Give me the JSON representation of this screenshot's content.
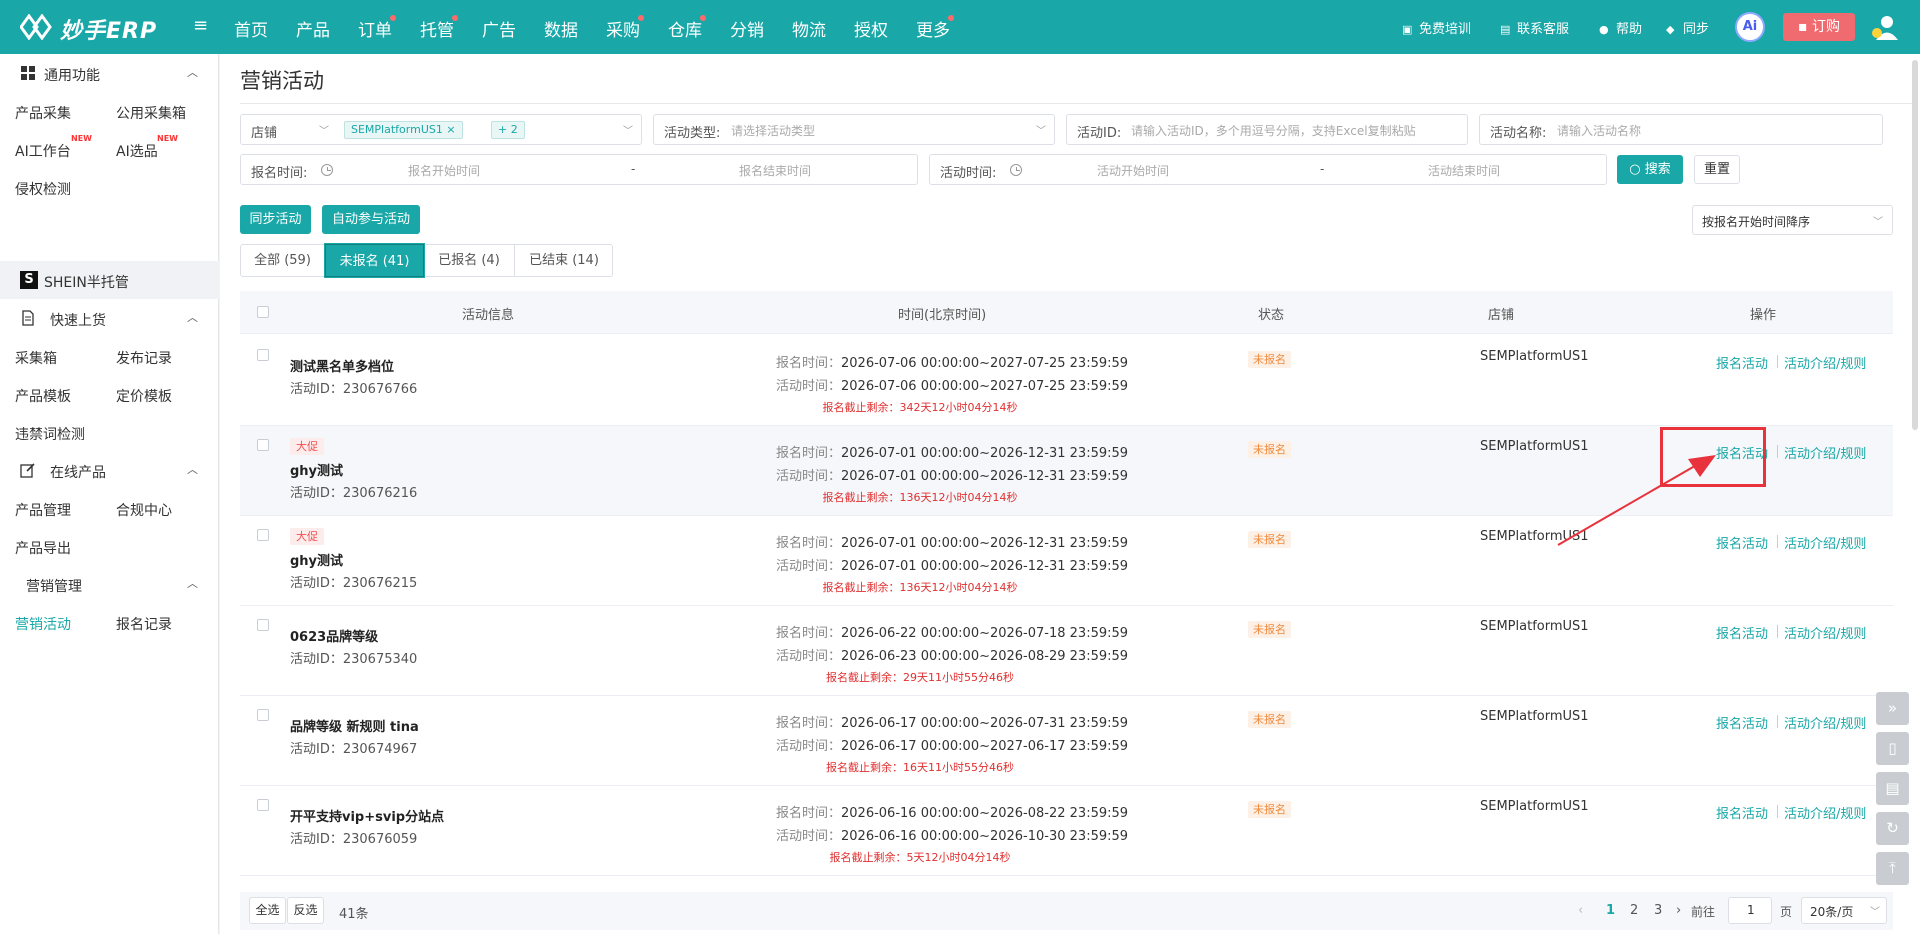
{
  "header": {
    "logo_text": "妙手ERP",
    "nav": [
      {
        "label": "首页",
        "dot": false
      },
      {
        "label": "产品",
        "dot": false
      },
      {
        "label": "订单",
        "dot": true
      },
      {
        "label": "托管",
        "dot": true
      },
      {
        "label": "广告",
        "dot": false
      },
      {
        "label": "数据",
        "dot": false
      },
      {
        "label": "采购",
        "dot": true
      },
      {
        "label": "仓库",
        "dot": true
      },
      {
        "label": "分销",
        "dot": false
      },
      {
        "label": "物流",
        "dot": false
      },
      {
        "label": "授权",
        "dot": false
      },
      {
        "label": "更多",
        "dot": true
      }
    ],
    "right": {
      "training": "免费培训",
      "service": "联系客服",
      "help": "帮助",
      "sync": "同步",
      "ai": "Ai",
      "order": "订购"
    }
  },
  "sidebar": {
    "general": "通用功能",
    "product_collect": "产品采集",
    "public_collect": "公用采集箱",
    "ai_workbench": "AI工作台",
    "ai_select": "AI选品",
    "new_badge": "NEW",
    "infringe": "侵权检测",
    "shein": "SHEIN半托管",
    "quick_upload": "快速上货",
    "collect_box": "采集箱",
    "publish_log": "发布记录",
    "product_template": "产品模板",
    "price_template": "定价模板",
    "banned_words": "违禁词检测",
    "online_products": "在线产品",
    "product_manage": "产品管理",
    "compliance": "合规中心",
    "product_export": "产品导出",
    "marketing": "营销管理",
    "campaigns": "营销活动",
    "signup_log": "报名记录"
  },
  "page": {
    "title": "营销活动",
    "filters": {
      "shop_label": "店铺",
      "shop_tag": "SEMPlatformUS1",
      "shop_more": "+ 2",
      "type_label": "活动类型:",
      "type_ph": "请选择活动类型",
      "id_label": "活动ID:",
      "id_ph": "请输入活动ID，多个用逗号分隔，支持Excel复制粘贴",
      "name_label": "活动名称:",
      "name_ph": "请输入活动名称",
      "signup_label": "报名时间:",
      "signup_start": "报名开始时间",
      "signup_end": "报名结束时间",
      "act_label": "活动时间:",
      "act_start": "活动开始时间",
      "act_end": "活动结束时间",
      "dash": "-",
      "search": "搜索",
      "reset": "重置"
    },
    "sync_btn": "同步活动",
    "auto_btn": "自动参与活动",
    "sort": "按报名开始时间降序",
    "tabs": [
      "全部 (59)",
      "未报名 (41)",
      "已报名 (4)",
      "已结束 (14)"
    ],
    "columns": {
      "info": "活动信息",
      "time": "时间(北京时间)",
      "status": "状态",
      "shop": "店铺",
      "ops": "操作"
    },
    "labels": {
      "signup_time": "报名时间：",
      "activity_time": "活动时间：",
      "remaining": "报名截止剩余：",
      "id_prefix": "活动ID：",
      "signup_op": "报名活动",
      "rules_op": "活动介绍/规则"
    },
    "rows": [
      {
        "promo": "",
        "name": "测试黑名单多档位",
        "id": "230676766",
        "signup": "2026-07-06 00:00:00~2027-07-25 23:59:59",
        "activity": "2026-07-06 00:00:00~2027-07-25 23:59:59",
        "remain": "342天12小时04分14秒",
        "status": "未报名",
        "shop": "SEMPlatformUS1"
      },
      {
        "promo": "大促",
        "name": "ghy测试",
        "id": "230676216",
        "signup": "2026-07-01 00:00:00~2026-12-31 23:59:59",
        "activity": "2026-07-01 00:00:00~2026-12-31 23:59:59",
        "remain": "136天12小时04分14秒",
        "status": "未报名",
        "shop": "SEMPlatformUS1"
      },
      {
        "promo": "大促",
        "name": "ghy测试",
        "id": "230676215",
        "signup": "2026-07-01 00:00:00~2026-12-31 23:59:59",
        "activity": "2026-07-01 00:00:00~2026-12-31 23:59:59",
        "remain": "136天12小时04分14秒",
        "status": "未报名",
        "shop": "SEMPlatformUS1"
      },
      {
        "promo": "",
        "name": "0623品牌等级",
        "id": "230675340",
        "signup": "2026-06-22 00:00:00~2026-07-18 23:59:59",
        "activity": "2026-06-23 00:00:00~2026-08-29 23:59:59",
        "remain": "29天11小时55分46秒",
        "status": "未报名",
        "shop": "SEMPlatformUS1"
      },
      {
        "promo": "",
        "name": "品牌等级 新规则 tina",
        "id": "230674967",
        "signup": "2026-06-17 00:00:00~2026-07-31 23:59:59",
        "activity": "2026-06-17 00:00:00~2027-06-17 23:59:59",
        "remain": "16天11小时55分46秒",
        "status": "未报名",
        "shop": "SEMPlatformUS1"
      },
      {
        "promo": "",
        "name": "开平支持vip+svip分站点",
        "id": "230676059",
        "signup": "2026-06-16 00:00:00~2026-08-22 23:59:59",
        "activity": "2026-06-16 00:00:00~2026-10-30 23:59:59",
        "remain": "5天12小时04分14秒",
        "status": "未报名",
        "shop": "SEMPlatformUS1"
      }
    ],
    "footer": {
      "select_all": "全选",
      "invert": "反选",
      "count": "41条",
      "pages": [
        "1",
        "2",
        "3"
      ],
      "goto": "前往",
      "page_val": "1",
      "page_unit": "页",
      "per_page": "20条/页"
    }
  }
}
